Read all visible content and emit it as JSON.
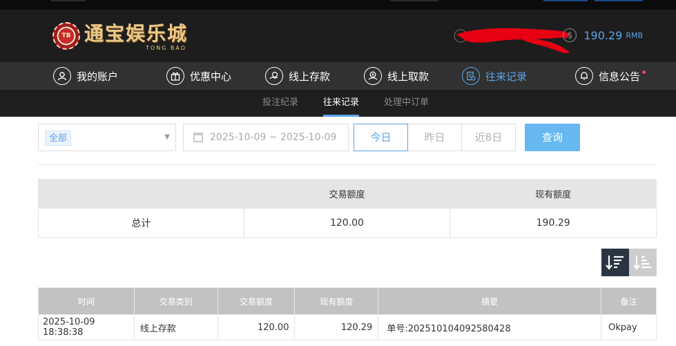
{
  "header": {
    "logo": {
      "badge": "TB",
      "name": "通宝娱乐城",
      "english": "TONG BAO"
    },
    "balance": {
      "amount": "190.29",
      "unit": "RMB"
    }
  },
  "nav": {
    "items": [
      {
        "label": "我的账户",
        "icon": "user-icon"
      },
      {
        "label": "优惠中心",
        "icon": "gift-icon"
      },
      {
        "label": "线上存款",
        "icon": "deposit-icon"
      },
      {
        "label": "线上取款",
        "icon": "withdraw-icon"
      },
      {
        "label": "往来记录",
        "icon": "records-icon",
        "active": true
      },
      {
        "label": "信息公告",
        "icon": "bell-icon"
      }
    ]
  },
  "subnav": {
    "items": [
      {
        "label": "投注纪录"
      },
      {
        "label": "往来记录",
        "active": true
      },
      {
        "label": "处理中订单"
      }
    ]
  },
  "filters": {
    "type_selected": "全部",
    "date_range": "2025-10-09 ~ 2025-10-09",
    "quick_ranges": [
      "今日",
      "昨日",
      "近8日"
    ],
    "active_range": "今日",
    "query_label": "查询"
  },
  "summary": {
    "headers": [
      "",
      "交易额度",
      "现有额度"
    ],
    "row": {
      "label": "总计",
      "amount": "120.00",
      "balance": "190.29"
    }
  },
  "records": {
    "headers": [
      "时间",
      "交易类别",
      "交易额度",
      "现有额度",
      "摘要",
      "备注"
    ],
    "rows": [
      {
        "time": "2025-10-09 18:38:38",
        "type": "线上存款",
        "amount": "120.00",
        "balance": "120.29",
        "summary": "单号:202510104092580428",
        "note": "Okpay"
      }
    ]
  },
  "colors": {
    "accent": "#5aa3e8",
    "nav_bg": "#313131",
    "header_bg": "#1d1d1d",
    "query_button": "#67b8f1"
  }
}
